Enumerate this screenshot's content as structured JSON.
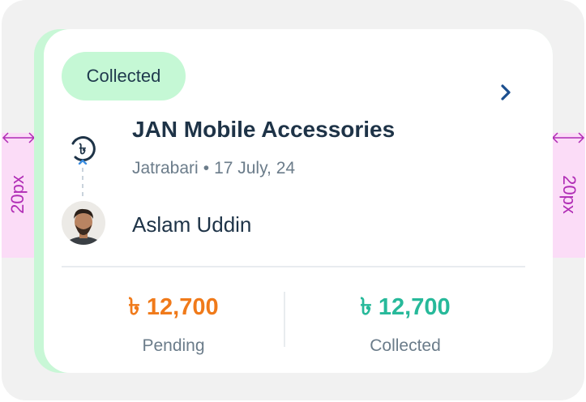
{
  "card": {
    "status_badge": "Collected",
    "shop_name": "JAN Mobile Accessories",
    "location": "Jatrabari",
    "separator": "•",
    "date": "17 July, 24",
    "person_name": "Aslam Uddin",
    "pending": {
      "amount": "৳ 12,700",
      "label": "Pending"
    },
    "collected": {
      "amount": "৳ 12,700",
      "label": "Collected"
    }
  },
  "annotations": {
    "left_spacing": "20px",
    "right_spacing": "20px"
  },
  "colors": {
    "accent_green": "#c5f8d5",
    "pending_orange": "#f07a1a",
    "collected_teal": "#27b99a",
    "annotation_magenta": "#b02cb5",
    "chevron_blue": "#1b4f8f"
  },
  "icons": {
    "chevron": "chevron-right-icon",
    "currency": "taka-collect-icon"
  }
}
